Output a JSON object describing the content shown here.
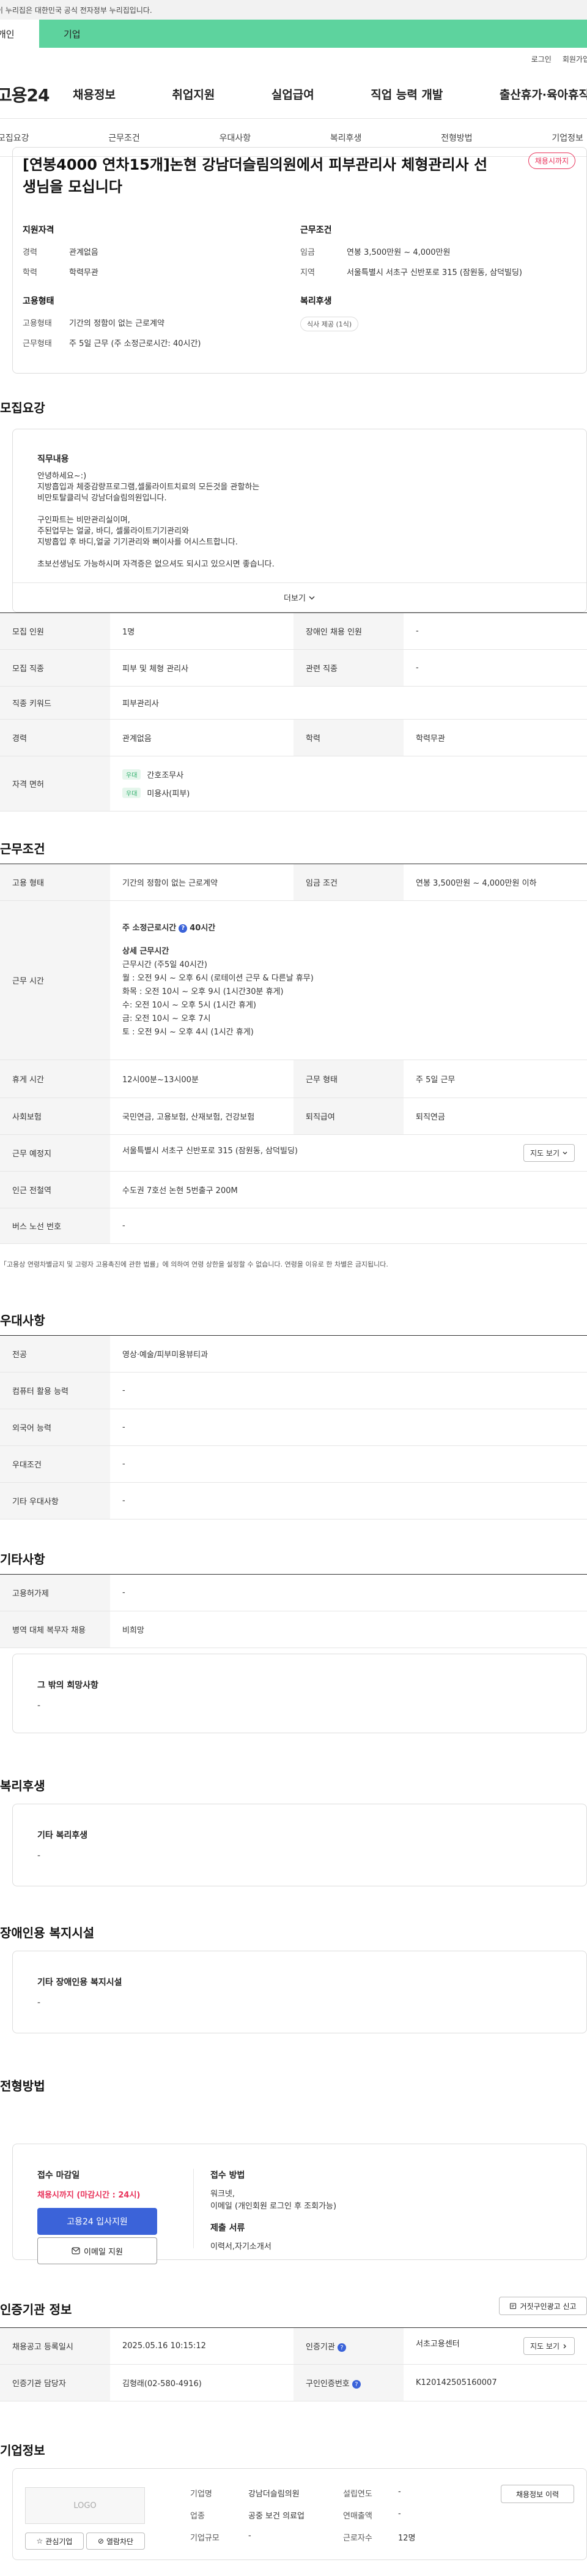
{
  "gov_banner": {
    "text": "이 누리집은 대한민국 공식 전자정부 누리집입니다."
  },
  "top_tabs": {
    "personal": "개인",
    "company": "기업"
  },
  "util": {
    "login": "로그인",
    "signup": "회원가입"
  },
  "gnb": {
    "logo": "고용24",
    "items": [
      "채용정보",
      "취업지원",
      "실업급여",
      "직업 능력 개발",
      "출산휴가·육아휴직"
    ]
  },
  "lnb": {
    "items": [
      "모집요강",
      "근무조건",
      "우대사항",
      "복리후생",
      "전형방법",
      "기업정보"
    ]
  },
  "headline": {
    "title": "[연봉4000 연차15개]논현 강남더슬림의원에서 피부관리사 체형관리사 선생님을 모십니다",
    "badge": "채용시까지",
    "qualification": {
      "heading": "지원자격",
      "rows": [
        {
          "k": "경력",
          "v": "관계없음"
        },
        {
          "k": "학력",
          "v": "학력무관"
        }
      ]
    },
    "employment": {
      "heading": "고용형태",
      "rows": [
        {
          "k": "고용형태",
          "v": "기간의 정함이 없는 근로계약"
        },
        {
          "k": "근무형태",
          "v": "주 5일 근무 (주 소정근로시간: 40시간)"
        }
      ]
    },
    "conditions": {
      "heading": "근무조건",
      "rows": [
        {
          "k": "임금",
          "v": "연봉 3,500만원 ~ 4,000만원"
        },
        {
          "k": "지역",
          "v": "서울특별시 서초구 신반포로 315 (잠원동, 삼덕빌딩)"
        }
      ]
    },
    "welfare": {
      "heading": "복리후생",
      "tag": "식사 제공 (1식)"
    }
  },
  "recruit": {
    "section_title": "모집요강",
    "job_content_heading": "직무내용",
    "job_content": "안녕하세요~:)\n지방흡입과 체중감량프로그램,셀룰라이트치료의 모든것을 관할하는\n비만토탈클리닉 강남더슬림의원입니다.\n\n구인파트는 비만관리실이며,\n주된업무는 얼굴, 바디, 셀룰라이트기기관리와\n지방흡입 후 바디,얼굴 기기관리와 뻐이사를 어시스트합니다.\n\n초보선생님도 가능하시며 자격증은 없으셔도 되시고 있으시면 좋습니다.",
    "more": "더보기",
    "table": [
      {
        "k1": "모집 인원",
        "v1": "1명",
        "k2": "장애인 채용 인원",
        "v2": "-"
      },
      {
        "k1": "모집 직종",
        "v1": "피부 및 체형 관리사",
        "k2": "관련 직종",
        "v2": "-"
      },
      {
        "k1": "직종 키워드",
        "v1": "피부관리사"
      },
      {
        "k1": "경력",
        "v1": "관계없음",
        "k2": "학력",
        "v2": "학력무관"
      }
    ],
    "license_label": "자격 면허",
    "licenses": [
      {
        "badge": "우대",
        "name": "간호조무사"
      },
      {
        "badge": "우대",
        "name": "미용사(피부)"
      }
    ]
  },
  "work": {
    "section_title": "근무조건",
    "employment_k": "고용 형태",
    "employment_v": "기간의 정함이 없는 근로계약",
    "wage_k": "임금 조건",
    "wage_v": "연봉 3,500만원 ~ 4,000만원 이하",
    "hours_k": "근무 시간",
    "hours_title": "주 소정근로시간",
    "hours_total": "40시간",
    "hours_detail_title": "상세 근무시간",
    "hours_lines": [
      "근무시간 (주5일 40시간)",
      "월 : 오전 9시 ~ 오후 6시 (로테이션 근무 & 다른날 휴무)",
      "화목 : 오전 10시 ~ 오후 9시 (1시간30분 휴게)",
      "수: 오전 10시 ~ 오후 5시 (1시간 휴게)",
      "금: 오전 10시 ~ 오후 7시",
      "토 : 오전 9시 ~ 오후 4시 (1시간 휴게)"
    ],
    "rest_k": "휴게 시간",
    "rest_v": "12시00분~13시00분",
    "type_k": "근무 형태",
    "type_v": "주 5일 근무",
    "insurance_k": "사회보험",
    "insurance_v": "국민연금, 고용보험, 산재보험, 건강보험",
    "severance_k": "퇴직급여",
    "severance_v": "퇴직연금",
    "place_k": "근무 예정지",
    "place_v": "서울특별시 서초구 신반포로 315 (잠원동, 삼덕빌딩)",
    "map_btn": "지도 보기",
    "subway_k": "인근 전철역",
    "subway_v": "수도권 7호선 논현 5번출구 200M",
    "bus_k": "버스 노선 번호",
    "bus_v": "-",
    "note": "「고용상 연령차별금지 및 고령자 고용촉진에 관한 법률」에 의하여 연령 상한을 설정할 수 없습니다. 연령을 이유로 한 차별은 금지됩니다."
  },
  "pref": {
    "section_title": "우대사항",
    "rows": [
      {
        "k": "전공",
        "v": "영상·예술/피부미용뷰티과"
      },
      {
        "k": "컴퓨터 활용 능력",
        "v": "-"
      },
      {
        "k": "외국어 능력",
        "v": "-"
      },
      {
        "k": "우대조건",
        "v": "-"
      },
      {
        "k": "기타 우대사항",
        "v": "-"
      }
    ]
  },
  "etc": {
    "section_title": "기타사항",
    "rows": [
      {
        "k": "고용허가제",
        "v": "-"
      },
      {
        "k": "병역 대체 복무자 채용",
        "v": "비희망"
      }
    ],
    "other_heading": "그 밖의 희망사항",
    "other_v": "-"
  },
  "welfare": {
    "section_title": "복리후생",
    "heading": "기타 복리후생",
    "v": "-"
  },
  "disability": {
    "section_title": "장애인용 복지시설",
    "heading": "기타 장애인용 복지시설",
    "v": "-"
  },
  "process": {
    "section_title": "전형방법",
    "deadline_h": "접수 마감일",
    "deadline_v": "채용시까지 (마감시간 : 24시)",
    "apply_btn": "고용24 입사지원",
    "email_btn": "이메일 지원",
    "method_h": "접수 방법",
    "method_v1": "워크넷,",
    "method_v2": "이메일 (개인회원 로그인 후 조회가능)",
    "docs_h": "제출 서류",
    "docs_v": "이력서,자기소개서"
  },
  "cert": {
    "section_title": "인증기관 정보",
    "report_btn": "거짓구인광고 신고",
    "reg_k": "채용공고 등록일시",
    "reg_v": "2025.05.16 10:15:12",
    "org_k": "인증기관",
    "org_v": "서초고용센터",
    "map_btn": "지도 보기",
    "mgr_k": "인증기관 담당자",
    "mgr_v": "김형래(02-580-4916)",
    "num_k": "구인인증번호",
    "num_v": "K120142505160007"
  },
  "company": {
    "section_title": "기업정보",
    "logo_placeholder": "LOGO",
    "interest_btn": "관심기업",
    "block_btn": "열람차단",
    "history_btn": "채용정보 이력",
    "name_k": "기업명",
    "name_v": "강남더슬림의원",
    "industry_k": "업종",
    "industry_v": "공중 보건 의료업",
    "size_k": "기업규모",
    "size_v": "-",
    "year_k": "설립연도",
    "year_v": "-",
    "sales_k": "연매출액",
    "sales_v": "-",
    "emp_k": "근로자수",
    "emp_v": "12명"
  }
}
